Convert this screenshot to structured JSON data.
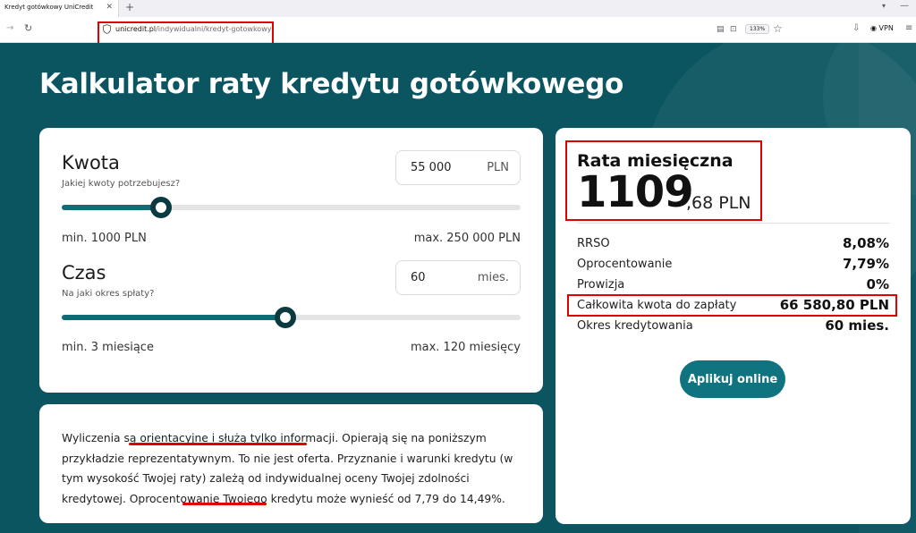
{
  "browser": {
    "tab_title": "Kredyt gotówkowy UniCredit",
    "url_domain": "unicredit.pl",
    "url_path": "/indywidualni/kredyt-gotowkowy",
    "zoom": "133%",
    "vpn_label": "VPN"
  },
  "calculator": {
    "title": "Kalkulator raty kredytu gotówkowego",
    "amount": {
      "label": "Kwota",
      "sublabel": "Jakiej kwoty potrzebujesz?",
      "value": "55 000",
      "unit": "PLN",
      "min_label": "min. 1000 PLN",
      "max_label": "max. 250 000 PLN",
      "min": 1000,
      "max": 250000,
      "current": 55000
    },
    "period": {
      "label": "Czas",
      "sublabel": "Na jaki okres spłaty?",
      "value": "60",
      "unit": "mies.",
      "min_label": "min. 3 miesiące",
      "max_label": "max. 120 miesięcy",
      "min": 3,
      "max": 120,
      "current": 60
    }
  },
  "note": {
    "p1": "Wyliczenia są ",
    "p2": "orientacyjne i służą tylko informacji",
    "p3": ". Opierają się na poniższym przykładzie reprezentatywnym. To nie jest oferta. Przyznanie i warunki kredytu (w tym wysokość Twojej raty) zależą od indywidualnej oceny Twojej zdolności kredytowej. Oprocentowanie Twojego kredytu może wynieść ",
    "p4": "od 7,79 do 14,49%",
    "p5": "."
  },
  "result": {
    "title": "Rata miesięczna",
    "installment_int": "1109",
    "installment_frac": ",68 PLN",
    "rows": [
      {
        "label": "RRSO",
        "value": "8,08%"
      },
      {
        "label": "Oprocentowanie",
        "value": "7,79%"
      },
      {
        "label": "Prowizja",
        "value": "0%"
      },
      {
        "label": "Całkowita kwota do zapłaty",
        "value": "66 580,80 PLN"
      },
      {
        "label": "Okres kredytowania",
        "value": "60 mies."
      }
    ],
    "apply_label": "Aplikuj online"
  },
  "colors": {
    "page_bg": "#0a5560",
    "accent": "#0f7480",
    "slider_fill": "#0f6b74",
    "highlight": "#e00000"
  }
}
